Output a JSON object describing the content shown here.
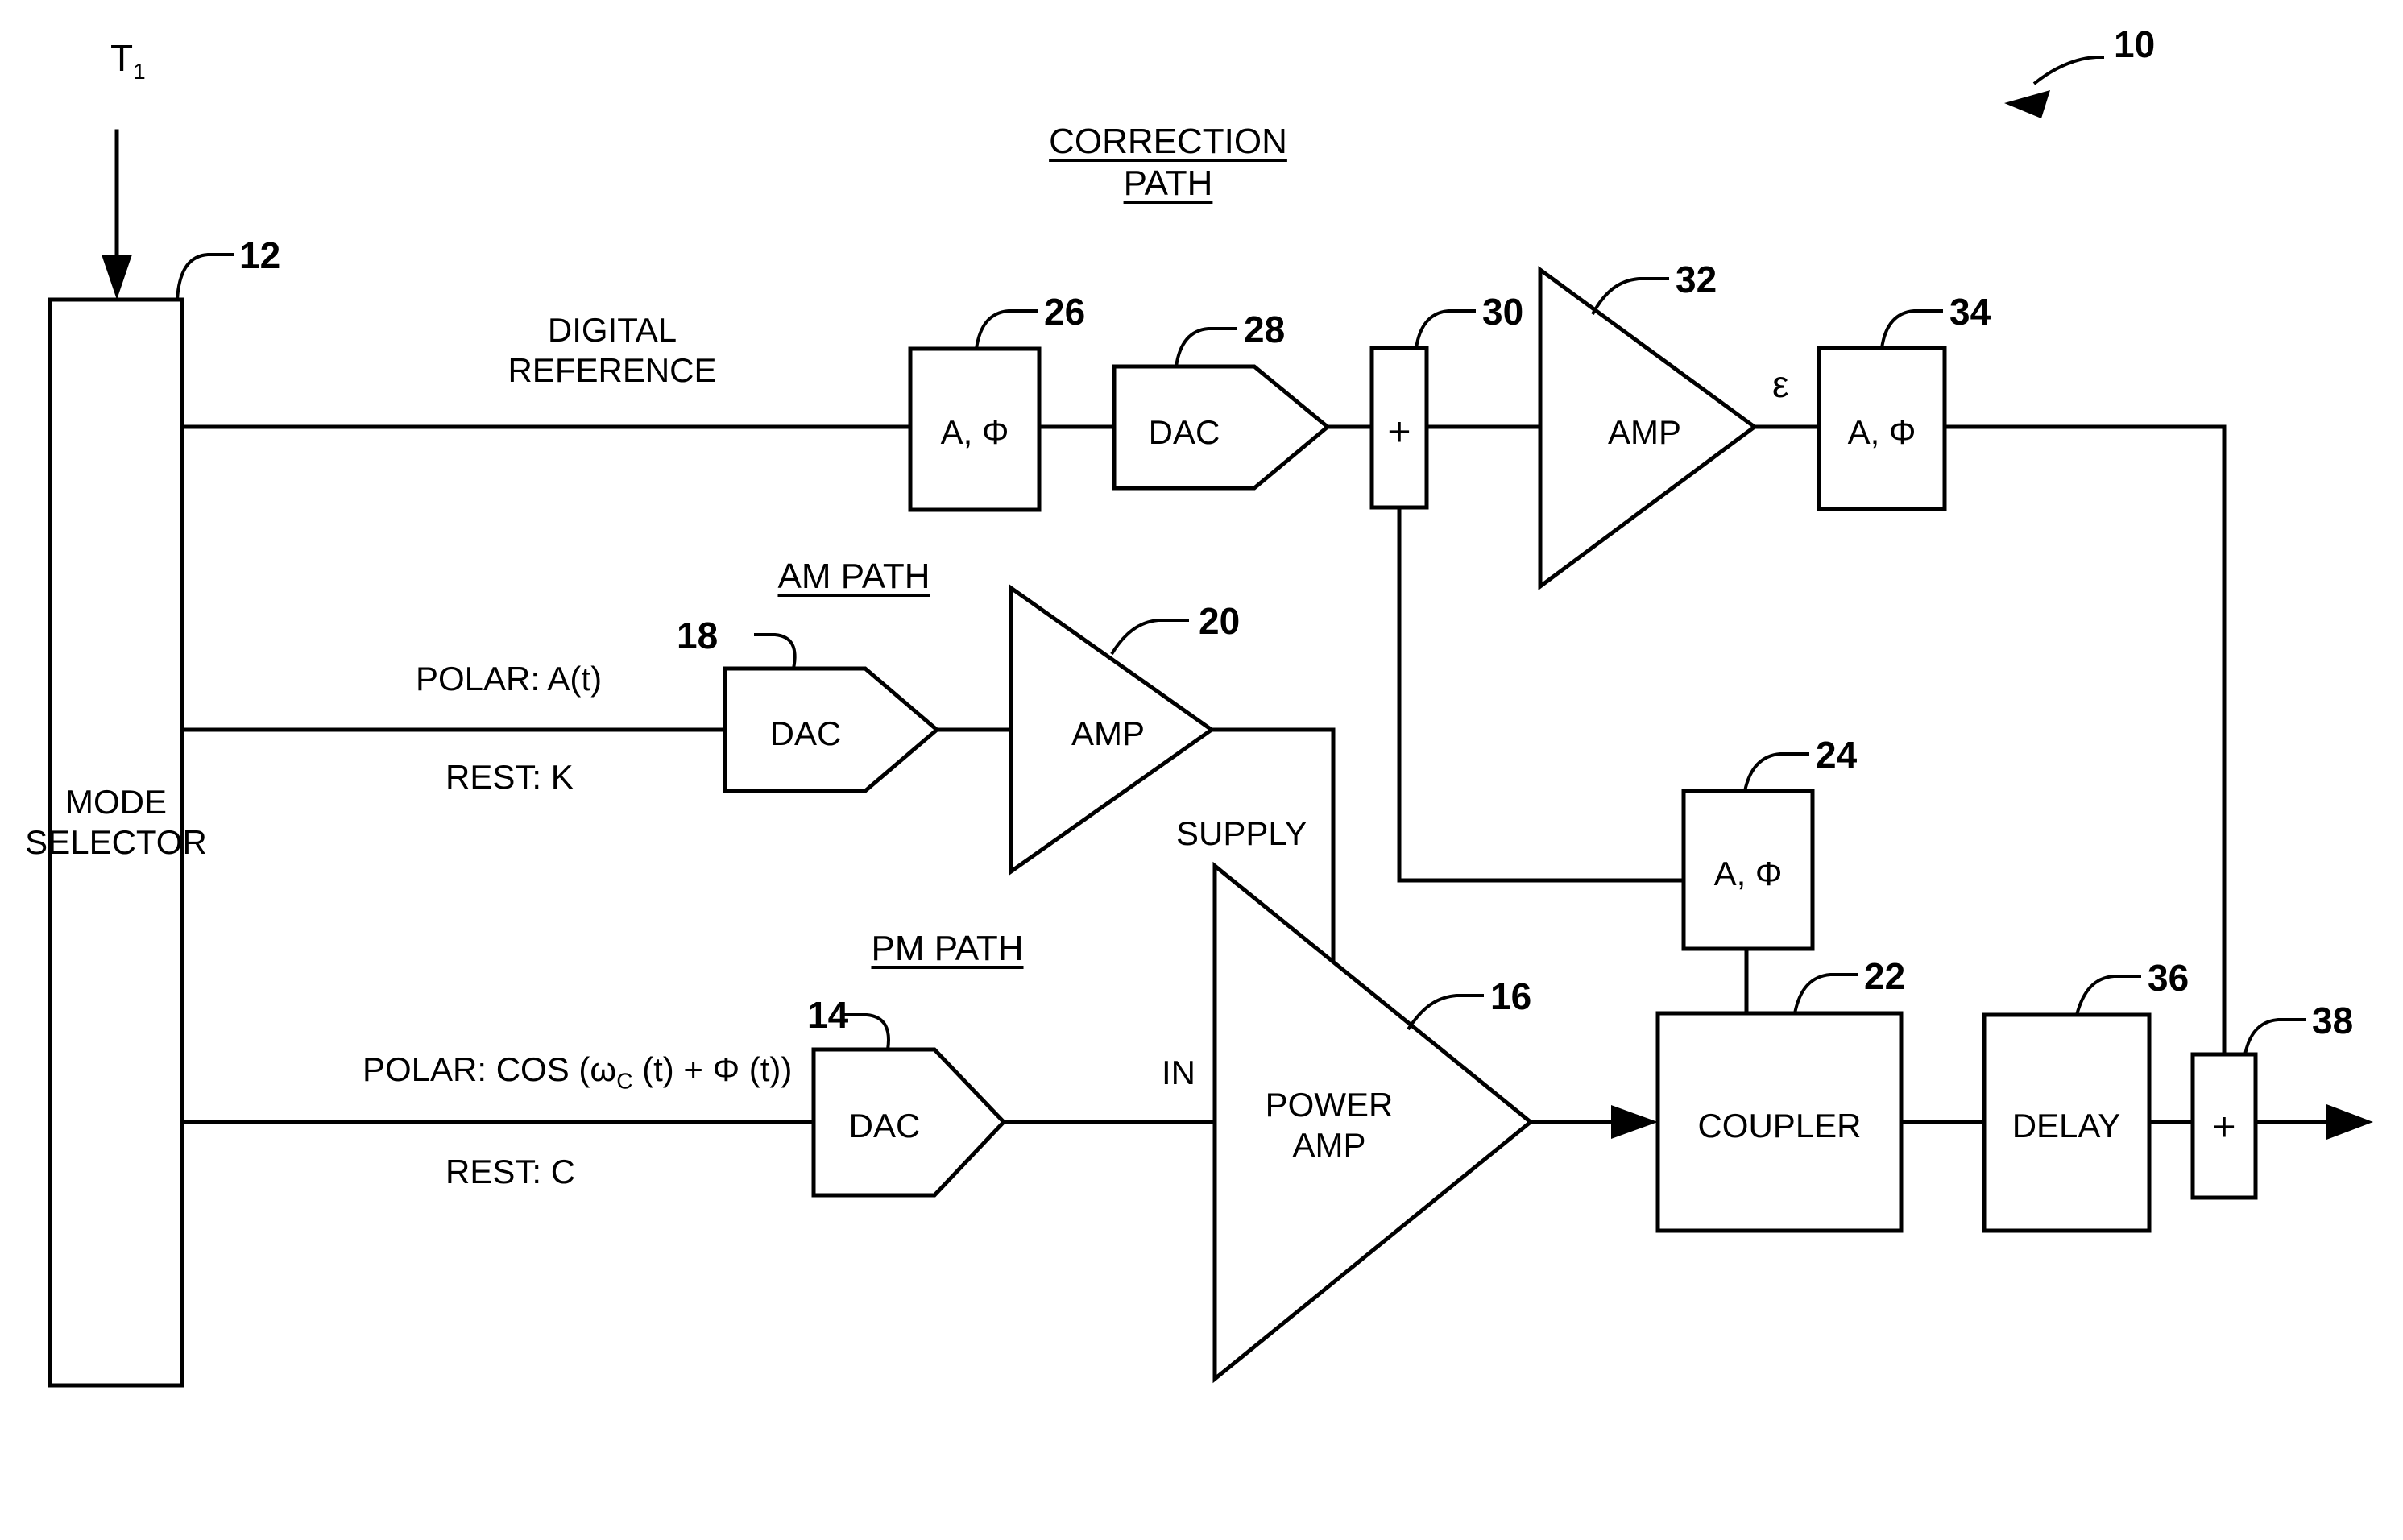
{
  "figure": {
    "system_reference": "10",
    "input_label": "T",
    "input_label_subscript": "1"
  },
  "blocks": {
    "mode_selector": {
      "label_line1": "MODE",
      "label_line2": "SELECTOR",
      "ref": "12"
    },
    "pm_dac": {
      "label": "DAC",
      "ref": "14"
    },
    "power_amp": {
      "label_line1": "POWER",
      "label_line2": "AMP",
      "ref": "16"
    },
    "am_dac": {
      "label": "DAC",
      "ref": "18"
    },
    "am_amp": {
      "label": "AMP",
      "ref": "20"
    },
    "coupler": {
      "label": "COUPLER",
      "ref": "22"
    },
    "feedback_aphi": {
      "label": "A, Φ",
      "ref": "24"
    },
    "ref_aphi": {
      "label": "A, Φ",
      "ref": "26"
    },
    "ref_dac": {
      "label": "DAC",
      "ref": "28"
    },
    "error_summer": {
      "label": "+",
      "ref": "30"
    },
    "error_amp": {
      "label": "AMP",
      "ref": "32"
    },
    "correction_aphi": {
      "label": "A, Φ",
      "ref": "34"
    },
    "delay": {
      "label": "DELAY",
      "ref": "36"
    },
    "output_summer": {
      "label": "+",
      "ref": "38"
    }
  },
  "path_titles": {
    "correction_line1": "CORRECTION",
    "correction_line2": "PATH",
    "am_path": "AM PATH",
    "pm_path": "PM PATH"
  },
  "signals": {
    "digital_reference_line1": "DIGITAL",
    "digital_reference_line2": "REFERENCE",
    "am_polar": "POLAR: A(t)",
    "am_rest": "REST: K",
    "pm_polar_prefix": "POLAR: COS (ω",
    "pm_polar_subscript": "C",
    "pm_polar_suffix": " (t) + Φ (t))",
    "pm_rest": "REST: C",
    "supply": "SUPPLY",
    "power_amp_in": "IN",
    "epsilon": "ε"
  },
  "colors": {
    "line": "#000000",
    "background": "#ffffff",
    "text": "#000000"
  }
}
